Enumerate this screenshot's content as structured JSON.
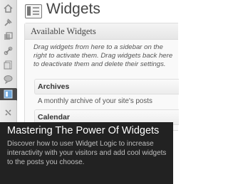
{
  "page": {
    "title": "Widgets"
  },
  "available_widgets": {
    "header": "Available Widgets",
    "description": "Drag widgets from here to a sidebar on the right to activate them. Drag widgets back here to deactivate them and delete their settings.",
    "items": [
      {
        "title": "Archives",
        "description": "A monthly archive of your site's posts"
      },
      {
        "title": "Calendar"
      }
    ]
  },
  "rail": {
    "icons": [
      "home-icon",
      "pin-icon",
      "media-icon",
      "links-icon",
      "pages-icon",
      "comments-icon",
      "appearance-icon",
      "plugins-icon"
    ],
    "active": "appearance-icon"
  },
  "caption": {
    "title": "Mastering The Power Of Widgets",
    "text": "Discover how to user Widget Logic to increase interactivity with your visitors and add cool widgets to the posts you choose."
  },
  "colors": {
    "overlay": "#222222",
    "caption_title": "#ffffff",
    "caption_text": "#bfbfbf"
  }
}
